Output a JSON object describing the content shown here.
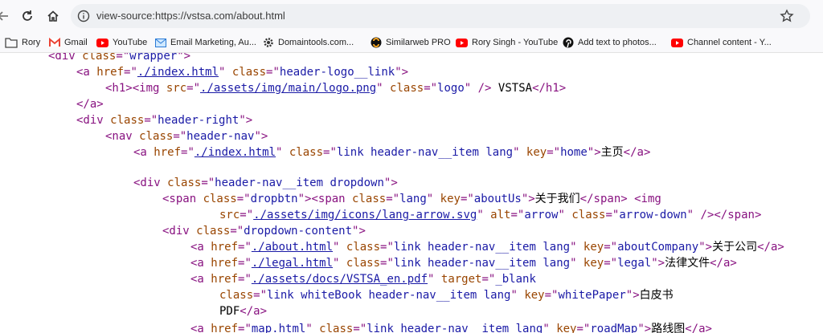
{
  "browser": {
    "url": "view-source:https://vstsa.com/about.html",
    "icons": {
      "back": "back-arrow-icon",
      "reload": "reload-icon",
      "home": "home-icon",
      "info": "info-icon",
      "star": "bookmark-star-icon"
    }
  },
  "bookmarks": [
    {
      "label": "Rory",
      "icon": "folder-icon"
    },
    {
      "label": "Gmail",
      "icon": "gmail-icon"
    },
    {
      "label": "YouTube",
      "icon": "youtube-icon"
    },
    {
      "label": "Email Marketing, Au...",
      "icon": "mail-icon"
    },
    {
      "label": "Domaintools.com...",
      "icon": "gear-icon"
    },
    {
      "label": "Similarweb PRO",
      "icon": "similarweb-icon"
    },
    {
      "label": "Rory Singh - YouTube",
      "icon": "youtube-icon"
    },
    {
      "label": "Add text to photos...",
      "icon": "pinterest-icon"
    },
    {
      "label": "Channel content - Y...",
      "icon": "youtube-icon"
    }
  ],
  "source": {
    "line0": {
      "t1": "<div ",
      "a1": "class",
      "eq": "=\"",
      "v1": "wrapper",
      "t2": "\">"
    },
    "line1": {
      "t1": "<a ",
      "a1": "href",
      "q1": "=\"",
      "lk": "./index.html",
      "q2": "\" ",
      "a2": "class",
      "q3": "=\"",
      "v2": "header-logo__link",
      "t2": "\">"
    },
    "line2": {
      "t1": "<h1><img ",
      "a1": "src",
      "q1": "=\"",
      "lk": "./assets/img/main/logo.png",
      "q2": "\" ",
      "a2": "class",
      "q3": "=\"",
      "v2": "logo",
      "t2": "\" />",
      "txt": " VSTSA",
      "t3": "</h1>"
    },
    "line3": {
      "t1": "</a>"
    },
    "line4": {
      "t1": "<div ",
      "a1": "class",
      "q1": "=\"",
      "v1": "header-right",
      "t2": "\">"
    },
    "line5": {
      "t1": "<nav ",
      "a1": "class",
      "q1": "=\"",
      "v1": "header-nav",
      "t2": "\">"
    },
    "line6": {
      "t1": "<a ",
      "a1": "href",
      "q1": "=\"",
      "lk": "./index.html",
      "q2": "\" ",
      "a2": "class",
      "q3": "=\"",
      "v2": "link header-nav__item lang",
      "q4": "\" ",
      "a3": "key",
      "q5": "=\"",
      "v3": "home",
      "t2": "\">",
      "txt": "主页",
      "t3": "</a>"
    },
    "line7": {
      "t1": "<div ",
      "a1": "class",
      "q1": "=\"",
      "v1": "header-nav__item dropdown",
      "t2": "\">"
    },
    "line8": {
      "t1": "<span ",
      "a1": "class",
      "q1": "=\"",
      "v1": "dropbtn",
      "t2": "\"><span ",
      "a2": "class",
      "q2": "=\"",
      "v2": "lang",
      "q3": "\" ",
      "a3": "key",
      "q4": "=\"",
      "v3": "aboutUs",
      "t3": "\">",
      "txt": "关于我们",
      "t4": "</span> <img"
    },
    "line9": {
      "a1": "src",
      "q1": "=\"",
      "lk": "./assets/img/icons/lang-arrow.svg",
      "q2": "\" ",
      "a2": "alt",
      "q3": "=\"",
      "v2": "arrow",
      "q4": "\" ",
      "a3": "class",
      "q5": "=\"",
      "v3": "arrow-down",
      "t1": "\" /></span>"
    },
    "line10": {
      "t1": "<div ",
      "a1": "class",
      "q1": "=\"",
      "v1": "dropdown-content",
      "t2": "\">"
    },
    "line11": {
      "t1": "<a ",
      "a1": "href",
      "q1": "=\"",
      "lk": "./about.html",
      "q2": "\" ",
      "a2": "class",
      "q3": "=\"",
      "v2": "link header-nav__item lang",
      "q4": "\" ",
      "a3": "key",
      "q5": "=\"",
      "v3": "aboutCompany",
      "t2": "\">",
      "txt": "关于公司",
      "t3": "</a>"
    },
    "line12": {
      "t1": "<a ",
      "a1": "href",
      "q1": "=\"",
      "lk": "./legal.html",
      "q2": "\" ",
      "a2": "class",
      "q3": "=\"",
      "v2": "link header-nav__item lang",
      "q4": "\" ",
      "a3": "key",
      "q5": "=\"",
      "v3": "legal",
      "t2": "\">",
      "txt": "法律文件",
      "t3": "</a>"
    },
    "line13": {
      "t1": "<a ",
      "a1": "href",
      "q1": "=\"",
      "lk": "./assets/docs/VSTSA_en.pdf",
      "q2": "\" ",
      "a2": "target",
      "q3": "=\"",
      "v2": "_blank"
    },
    "line14": {
      "q0": "\"",
      "a1": "class",
      "q1": "=\"",
      "v1": "link whiteBook header-nav__item lang",
      "q2": "\" ",
      "a2": "key",
      "q3": "=\"",
      "v2": "whitePaper",
      "t1": "\">",
      "txt": "白皮书"
    },
    "line15": {
      "txt": "PDF",
      "t1": "</a>"
    },
    "line16": {
      "t1": "<a ",
      "a1": "href",
      "q1": "=\"",
      "lk": "map.html",
      "q2": "\" ",
      "a2": "class",
      "q3": "=\"",
      "v2": "link header-nav__item lang",
      "q4": "\" ",
      "a3": "key",
      "q5": "=\"",
      "v3": "roadMap",
      "t2": "\">",
      "txt": "路线图",
      "t3": "</a>"
    }
  }
}
